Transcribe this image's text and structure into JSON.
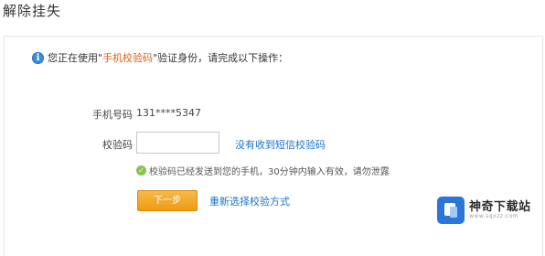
{
  "page": {
    "title": "解除挂失"
  },
  "notice": {
    "prefix": "您正在使用\"",
    "method": "手机校验码",
    "suffix": "\"验证身份，请完成以下操作："
  },
  "form": {
    "phone_label": "手机号码",
    "phone_value": "131****5347",
    "code_label": "校验码",
    "code_value": "",
    "code_placeholder": "",
    "resend_link": "没有收到短信校验码",
    "sent_message": "校验码已经发送到您的手机，30分钟内输入有效，请勿泄露",
    "next_button": "下一步",
    "reselect_link": "重新选择校验方式"
  },
  "watermark": {
    "name": "神奇下载站",
    "url": "www.sqxzz.com"
  },
  "colors": {
    "accent": "#ee9b12",
    "link": "#1a73c9",
    "highlight": "#e35b1c",
    "success": "#8cc152",
    "info": "#3b8fd6"
  },
  "icons": {
    "info": "info-icon",
    "check": "check-icon"
  }
}
